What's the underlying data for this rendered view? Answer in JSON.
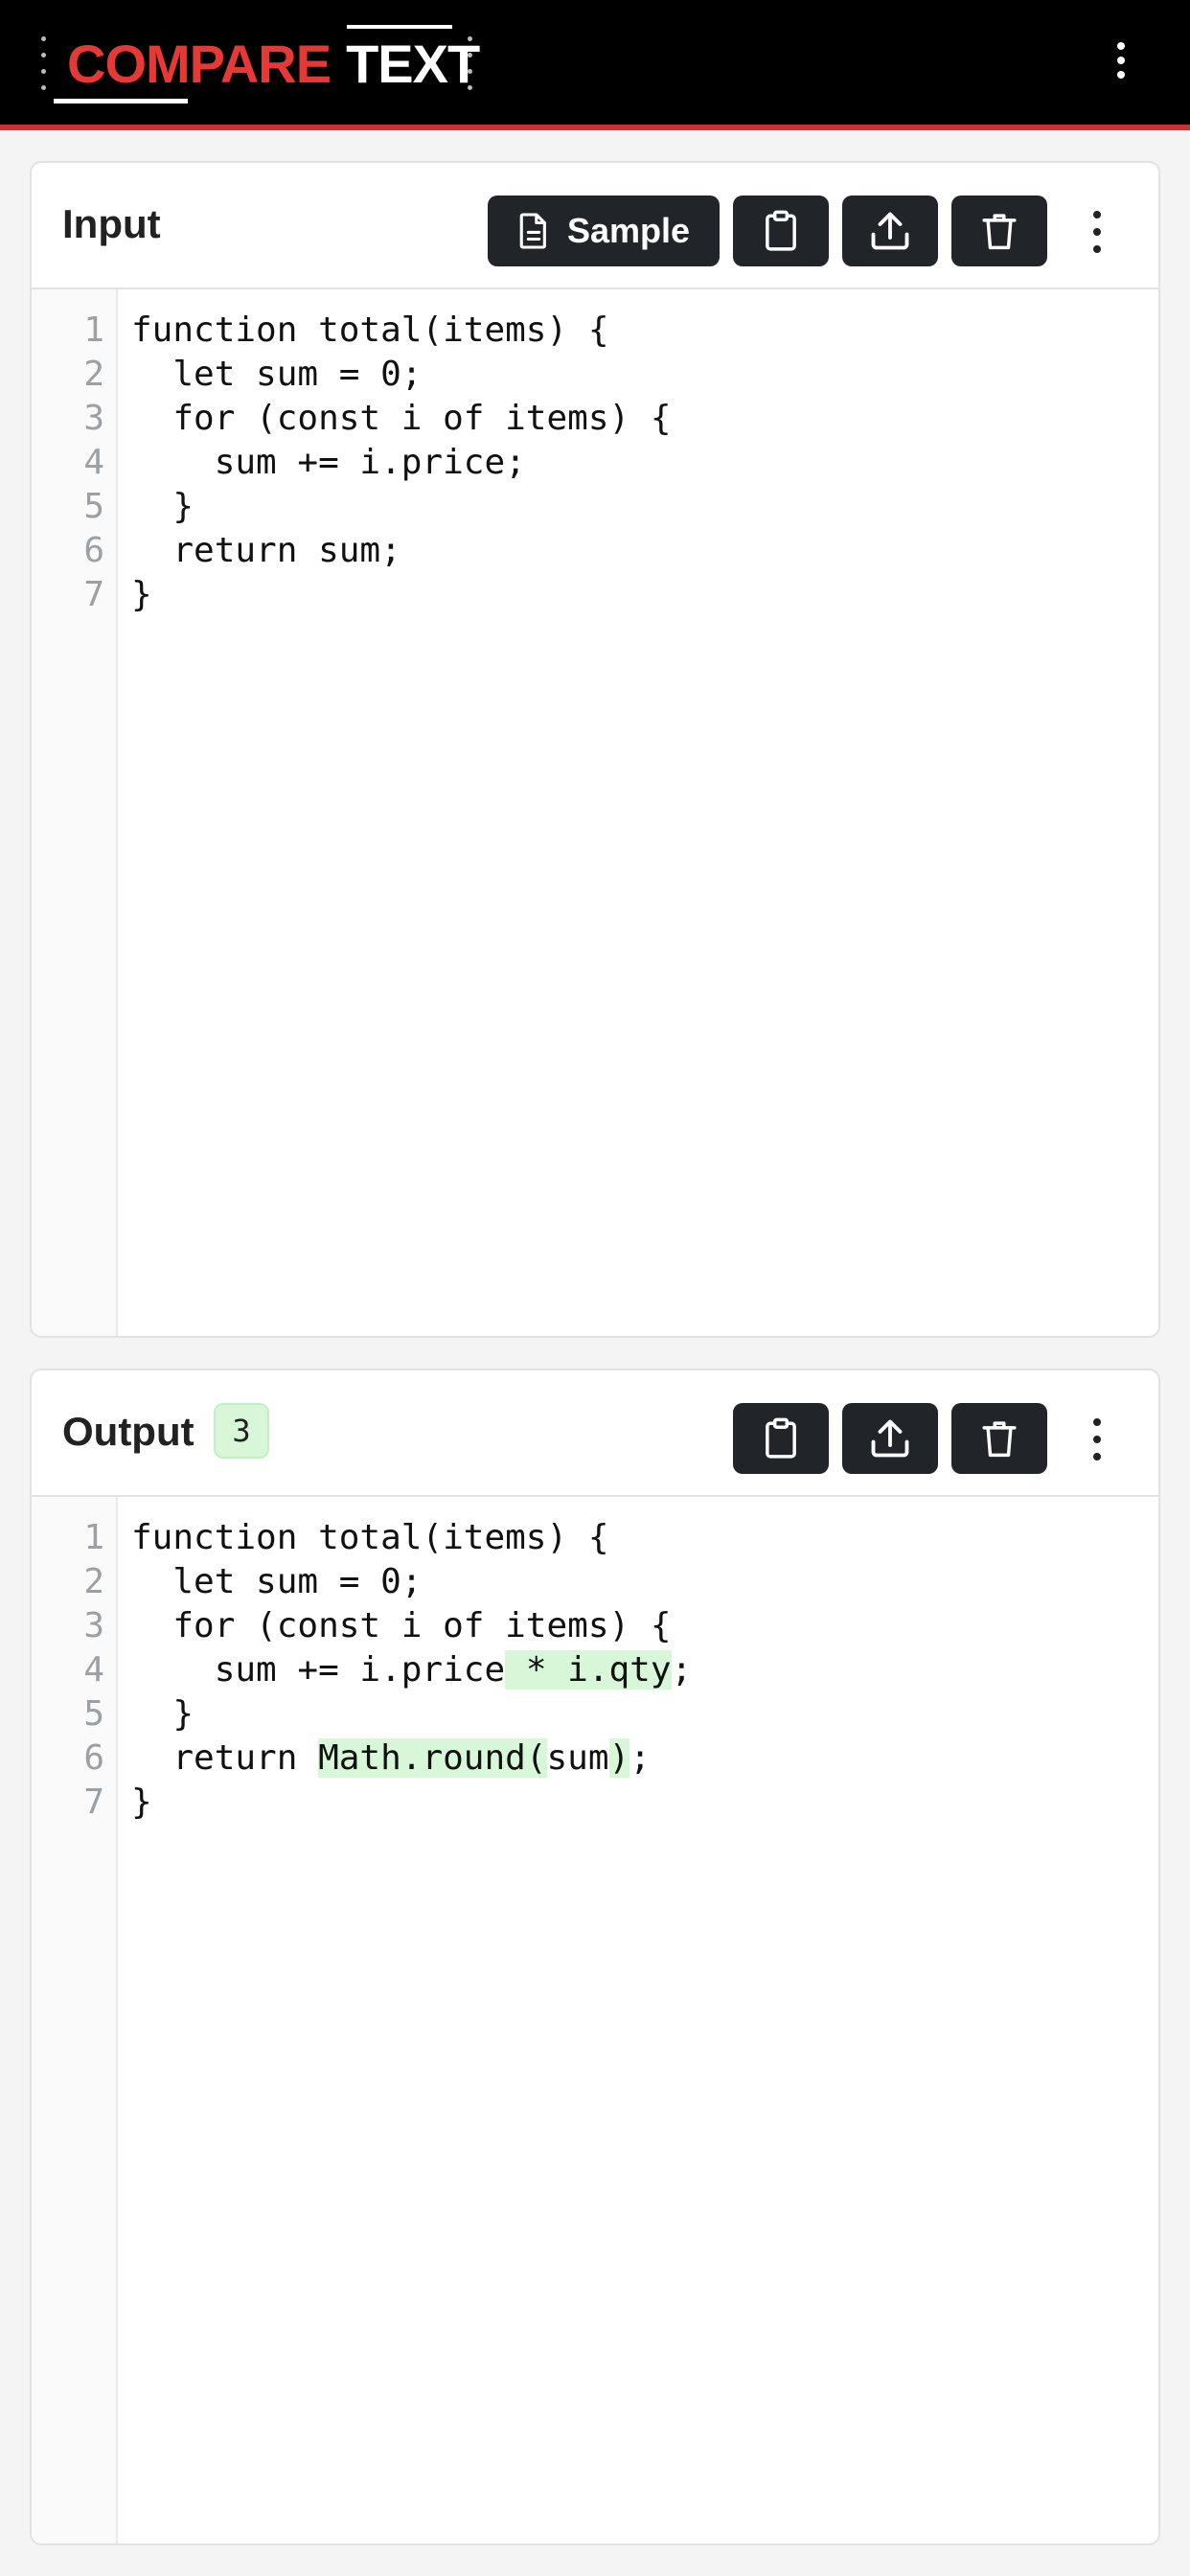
{
  "header": {
    "logo_word1": "COMPARE",
    "logo_word2": "TEXT",
    "menu_icon": "more-vertical-icon",
    "accent_color": "#e53935"
  },
  "input": {
    "title": "Input",
    "sample_label": "Sample",
    "buttons": [
      "clipboard-icon",
      "upload-icon",
      "trash-icon",
      "more-vertical-icon"
    ],
    "line_numbers": [
      "1",
      "2",
      "3",
      "4",
      "5",
      "6",
      "7"
    ],
    "lines": [
      "function total(items) {",
      "  let sum = 0;",
      "  for (const i of items) {",
      "    sum += i.price;",
      "  }",
      "  return sum;",
      "}"
    ]
  },
  "output": {
    "title": "Output",
    "diff_count": "3",
    "buttons": [
      "clipboard-icon",
      "upload-icon",
      "trash-icon",
      "more-vertical-icon"
    ],
    "line_numbers": [
      "1",
      "2",
      "3",
      "4",
      "5",
      "6",
      "7"
    ],
    "lines": [
      {
        "segments": [
          {
            "t": "function total(items) {",
            "h": false
          }
        ]
      },
      {
        "segments": [
          {
            "t": "  let sum = 0;",
            "h": false
          }
        ]
      },
      {
        "segments": [
          {
            "t": "  for (const i of items) {",
            "h": false
          }
        ]
      },
      {
        "segments": [
          {
            "t": "    sum += i.price",
            "h": false
          },
          {
            "t": " * i.qty",
            "h": true
          },
          {
            "t": ";",
            "h": false
          }
        ]
      },
      {
        "segments": [
          {
            "t": "  }",
            "h": false
          }
        ]
      },
      {
        "segments": [
          {
            "t": "  return ",
            "h": false
          },
          {
            "t": "Math.round(",
            "h": true
          },
          {
            "t": "sum",
            "h": false
          },
          {
            "t": ")",
            "h": true
          },
          {
            "t": ";",
            "h": false
          }
        ]
      },
      {
        "segments": [
          {
            "t": "}",
            "h": false
          }
        ]
      }
    ],
    "highlight_color": "#d8f7d8"
  }
}
